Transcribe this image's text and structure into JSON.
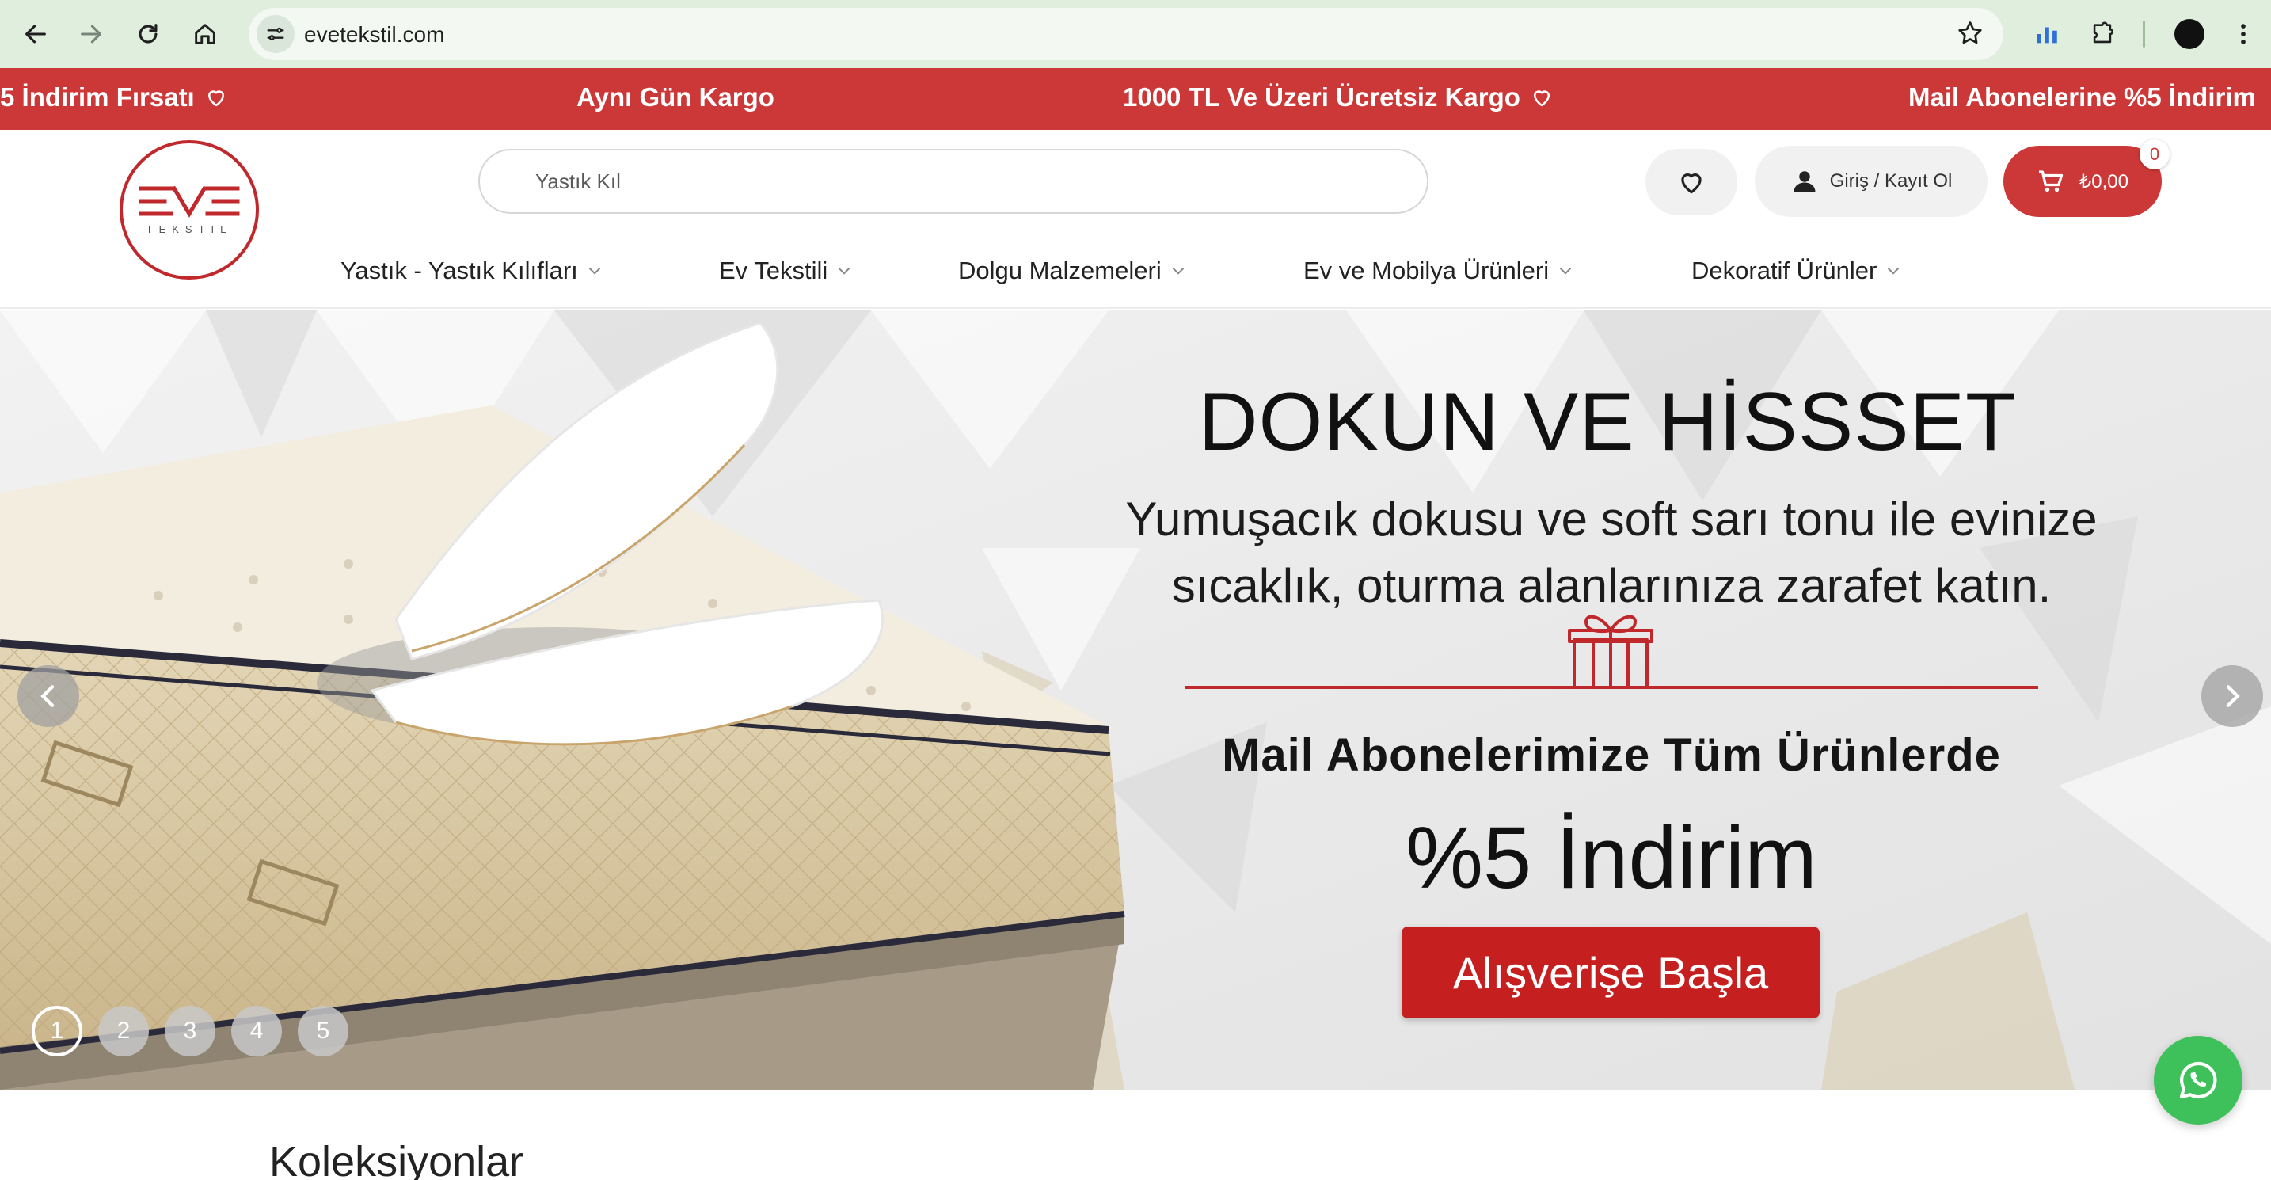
{
  "browser": {
    "url": "evetekstil.com",
    "back_icon": "arrow-left-icon",
    "forward_icon": "arrow-right-icon",
    "reload_icon": "reload-icon",
    "home_icon": "home-icon",
    "site_info_icon": "tune-icon",
    "bookmark_icon": "star-icon",
    "extensions_icon": "puzzle-icon",
    "menu_icon": "kebab-menu-icon"
  },
  "promo_bar": {
    "background": "#cc3837",
    "items": [
      "5 İndirim Fırsatı",
      "Aynı Gün Kargo",
      "1000 TL Ve Üzeri Ücretsiz Kargo",
      "Mail Abonelerine %5 İndirim"
    ]
  },
  "header": {
    "logo_text": "EVE",
    "logo_subtext": "TEKSTIL",
    "search_placeholder": "Yastık Kıl",
    "login_label": "Giriş / Kayıt Ol",
    "cart_total": "₺0,00",
    "cart_count": "0"
  },
  "nav": {
    "items": [
      "Yastık - Yastık Kılıfları",
      "Ev Tekstili",
      "Dolgu Malzemeleri",
      "Ev ve Mobilya Ürünleri",
      "Dekoratif Ürünler"
    ]
  },
  "hero": {
    "title": "DOKUN VE HİSSSET",
    "subtitle_line1": "Yumuşacık dokusu ve soft sarı tonu ile evinize",
    "subtitle_line2": "sıcaklık, oturma alanlarınıza zarafet katın.",
    "mail_text": "Mail Abonelerimize Tüm Ürünlerde",
    "discount_text": "%5 İndirim",
    "cta_label": "Alışverişe Başla",
    "accent": "#c5201f",
    "slides": [
      "1",
      "2",
      "3",
      "4",
      "5"
    ],
    "active_slide": "1"
  },
  "collections": {
    "title": "Koleksiyonlar"
  }
}
